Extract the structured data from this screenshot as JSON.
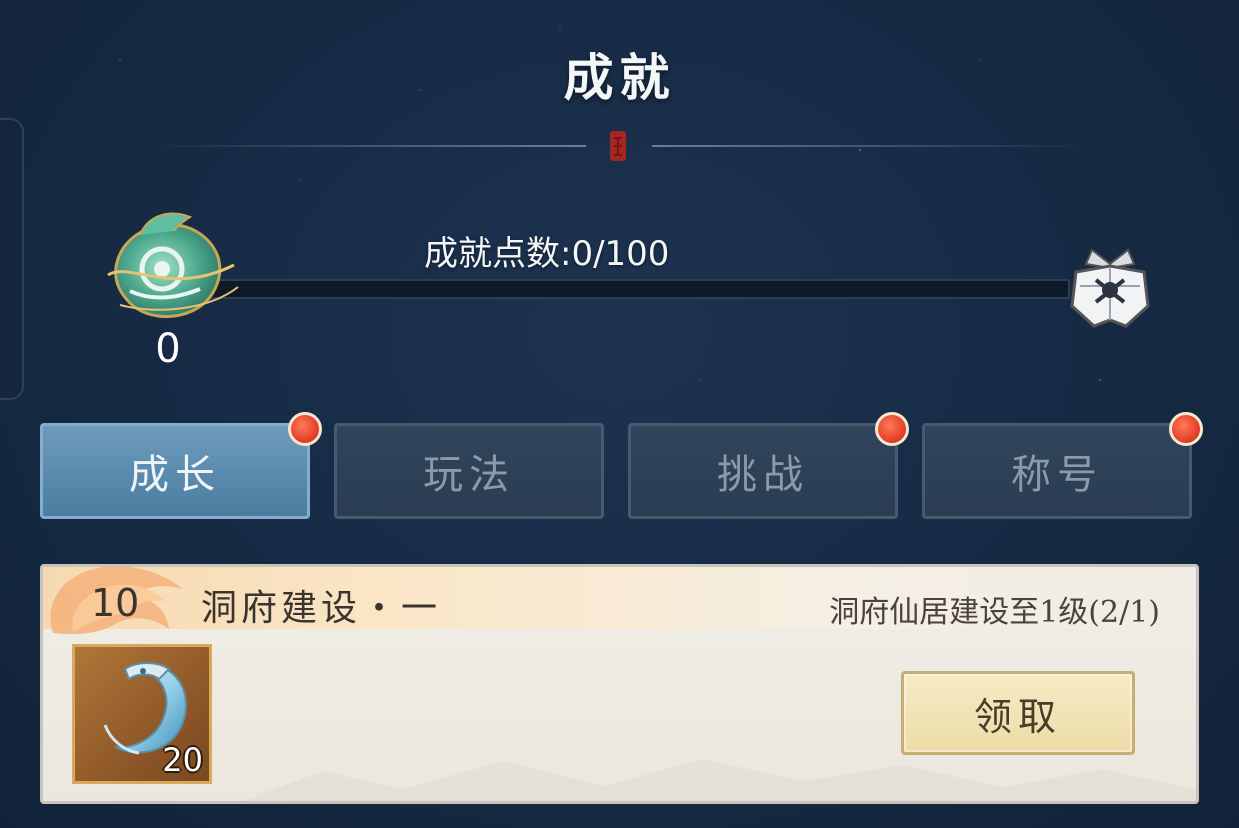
{
  "header": {
    "title": "成就"
  },
  "achievement_points": {
    "label": "成就点数:0/100",
    "current": 0,
    "max": 100,
    "level": "0"
  },
  "tabs": [
    {
      "label": "成长",
      "active": true,
      "notification": true
    },
    {
      "label": "玩法",
      "active": false,
      "notification": false
    },
    {
      "label": "挑战",
      "active": false,
      "notification": true
    },
    {
      "label": "称号",
      "active": false,
      "notification": true
    }
  ],
  "achievement_card": {
    "points": "10",
    "title": "洞府建设・一",
    "condition": "洞府仙居建设至1级(2/1)",
    "reward": {
      "icon": "jade-crescent-icon",
      "count": "20"
    },
    "claim_label": "领取"
  },
  "colors": {
    "background": "#162a44",
    "tab_active": "#5b8cb0",
    "tab_inactive": "#2f4358",
    "notification_dot": "#e5432a",
    "card_bg": "#ede9e1",
    "claim_button": "#f0e2b4"
  }
}
